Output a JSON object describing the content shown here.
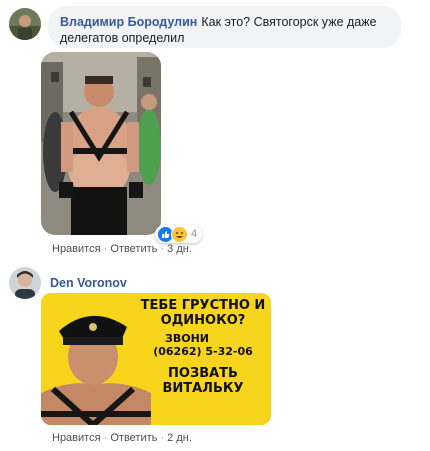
{
  "comment1": {
    "author": "Владимир Бородулин",
    "text": "Как это? Святогорск уже даже делегатов определил",
    "reaction_count": "4",
    "actions": {
      "like": "Нравится",
      "reply": "Ответить",
      "time": "3 дн."
    }
  },
  "comment2": {
    "author": "Den Voronov",
    "actions": {
      "like": "Нравится",
      "reply": "Ответить",
      "time": "2 дн."
    },
    "ad": {
      "line1": "ТЕБЕ ГРУСТНО И",
      "line2": "ОДИНОКО?",
      "line3": "ЗВОНИ",
      "line4": "(06262) 5-32-06",
      "line5": "ПОЗВАТЬ",
      "line6": "ВИТАЛЬКУ"
    }
  },
  "colors": {
    "link": "#385898",
    "meta": "#90949c",
    "bubble": "#f2f3f5",
    "ad_bg": "#f7d51d",
    "like": "#1877f2"
  }
}
